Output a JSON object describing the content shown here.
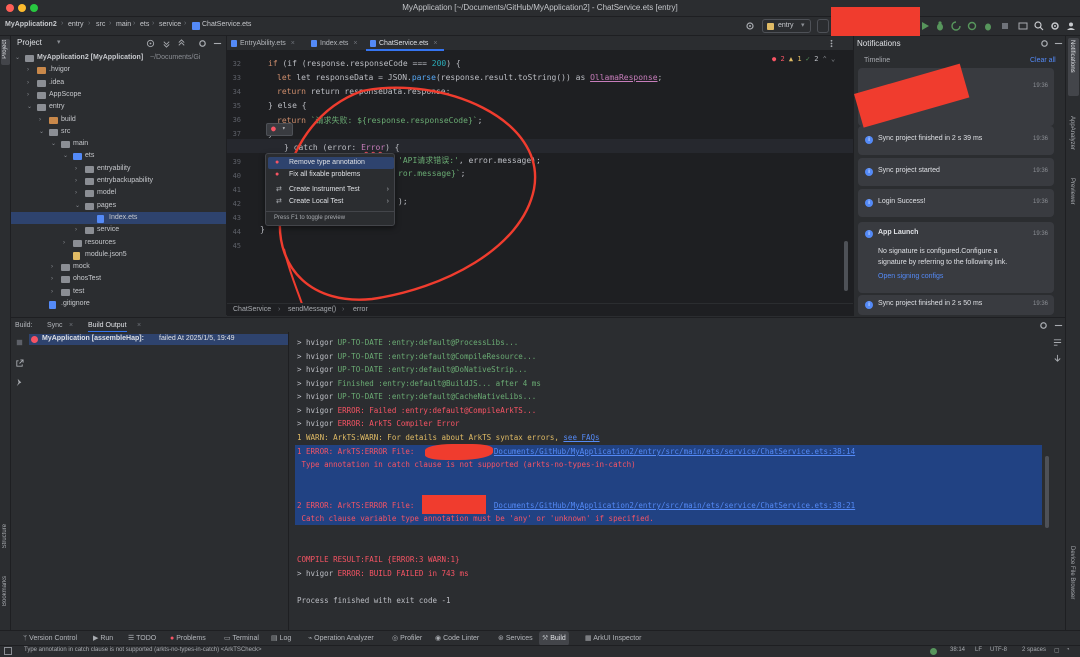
{
  "colors": {
    "accent": "#3574f0",
    "error": "#f75464",
    "success": "#6aab73",
    "warning": "#e0bb65",
    "redaction": "#f03c2e"
  },
  "window": {
    "title": "MyApplication [~/Documents/GitHub/MyApplication2] - ChatService.ets [entry]"
  },
  "navbar": {
    "breadcrumbs": [
      "MyApplication2",
      "entry",
      "src",
      "main",
      "ets",
      "service",
      "ChatService.ets"
    ],
    "run_config": "entry"
  },
  "project_panel": {
    "title": "Project",
    "tree": [
      {
        "label": "MyApplication2 [MyApplication]",
        "suffix": "~/Documents/Gi",
        "depth": 0,
        "expanded": true,
        "kind": "module"
      },
      {
        "label": ".hvigor",
        "depth": 1,
        "expanded": false,
        "kind": "folder-orange"
      },
      {
        "label": ".idea",
        "depth": 1,
        "expanded": false,
        "kind": "folder"
      },
      {
        "label": "AppScope",
        "depth": 1,
        "expanded": false,
        "kind": "folder"
      },
      {
        "label": "entry",
        "depth": 1,
        "expanded": true,
        "kind": "module"
      },
      {
        "label": "build",
        "depth": 2,
        "expanded": false,
        "kind": "folder-orange"
      },
      {
        "label": "src",
        "depth": 2,
        "expanded": true,
        "kind": "folder"
      },
      {
        "label": "main",
        "depth": 3,
        "expanded": true,
        "kind": "folder"
      },
      {
        "label": "ets",
        "depth": 4,
        "expanded": true,
        "kind": "folder-blue"
      },
      {
        "label": "entryability",
        "depth": 5,
        "expanded": false,
        "kind": "folder"
      },
      {
        "label": "entrybackupability",
        "depth": 5,
        "expanded": false,
        "kind": "folder"
      },
      {
        "label": "model",
        "depth": 5,
        "expanded": false,
        "kind": "folder"
      },
      {
        "label": "pages",
        "depth": 5,
        "expanded": true,
        "kind": "folder"
      },
      {
        "label": "Index.ets",
        "depth": 6,
        "kind": "file",
        "selected": true
      },
      {
        "label": "service",
        "depth": 5,
        "expanded": false,
        "kind": "folder"
      },
      {
        "label": "resources",
        "depth": 4,
        "expanded": false,
        "kind": "folder"
      },
      {
        "label": "module.json5",
        "depth": 4,
        "kind": "json"
      },
      {
        "label": "mock",
        "depth": 3,
        "expanded": false,
        "kind": "folder"
      },
      {
        "label": "ohosTest",
        "depth": 3,
        "expanded": false,
        "kind": "folder"
      },
      {
        "label": "test",
        "depth": 3,
        "expanded": false,
        "kind": "folder"
      },
      {
        "label": ".gitignore",
        "depth": 2,
        "kind": "file"
      }
    ]
  },
  "editor": {
    "tabs": [
      {
        "label": "EntryAbility.ets",
        "active": false
      },
      {
        "label": "Index.ets",
        "active": false
      },
      {
        "label": "ChatService.ets",
        "active": true
      }
    ],
    "inspection_counts": {
      "errors": "2",
      "warnings": "1",
      "weak": "2"
    },
    "line_numbers": [
      "32",
      "33",
      "34",
      "35",
      "36",
      "37",
      "38",
      "39",
      "40",
      "41",
      "42",
      "43",
      "44",
      "45"
    ],
    "code": {
      "l32": [
        "if (response.responseCode === ",
        "200",
        ") {"
      ],
      "l33": [
        "let responseData = JSON.",
        "parse",
        "(response.result.toString()) as ",
        "OllamaResponse",
        ";"
      ],
      "l34": [
        "return responseData.response;"
      ],
      "l35": [
        "} else {"
      ],
      "l36": [
        "return ",
        "`请求失败: ${response.responseCode}`",
        ";"
      ],
      "l37": [
        "}"
      ],
      "l38": [
        "} catch (error: ",
        "Error",
        ") {"
      ],
      "l39": [
        "'API请求错误:'",
        ", error.message);"
      ],
      "l40": [
        "ror.message}`",
        ";"
      ],
      "l41": [
        ");"
      ],
      "l43": [
        "}"
      ],
      "l44": [
        "}"
      ]
    },
    "popup": {
      "items": [
        {
          "label": "Remove type annotation",
          "highlighted": true,
          "submenu": false
        },
        {
          "label": "Fix all fixable problems",
          "highlighted": false,
          "submenu": false
        },
        {
          "label": "Create Instrument Test",
          "highlighted": false,
          "submenu": true
        },
        {
          "label": "Create Local Test",
          "highlighted": false,
          "submenu": true
        }
      ],
      "hint": "Press F1 to toggle preview"
    },
    "breadcrumb": [
      "ChatService",
      "sendMessage()",
      "error"
    ]
  },
  "notifications": {
    "title": "Notifications",
    "timeline_label": "Timeline",
    "clear_all": "Clear all",
    "cards": [
      {
        "title": "",
        "time": "19:36"
      },
      {
        "title": "Sync project finished in 2 s 39 ms",
        "time": "19:36"
      },
      {
        "title": "Sync project started",
        "time": "19:36"
      },
      {
        "title": "Login Success!",
        "time": "19:36"
      },
      {
        "title": "App Launch",
        "time": "19:36",
        "body_line1": "No signature is configured.Configure a",
        "body_line2": "signature by referring to the following link.",
        "link": "Open signing configs"
      },
      {
        "title": "Sync project finished in 2 s 50 ms",
        "time": "19:36"
      }
    ]
  },
  "right_stripe": {
    "top": [
      "Notifications",
      "AppAnalyzer",
      "Previewer"
    ],
    "bottom": [
      "Device File Browser"
    ]
  },
  "left_stripe": {
    "top": [
      "Project"
    ],
    "bottom": [
      "Structure",
      "Bookmarks"
    ]
  },
  "build_panel": {
    "tabs": [
      {
        "label": "Build:",
        "active": false
      },
      {
        "label": "Sync",
        "active": false
      },
      {
        "label": "Build Output",
        "active": true
      }
    ],
    "tree_item": {
      "name": "MyApplication [assembleHap]:",
      "status": "failed At 2025/1/5, 19:49"
    },
    "output": [
      {
        "prefix": "> hvigor ",
        "status": "UP-TO-DATE",
        "rest": " :entry:default@ProcessLibs..."
      },
      {
        "prefix": "> hvigor ",
        "status": "UP-TO-DATE",
        "rest": " :entry:default@CompileResource..."
      },
      {
        "prefix": "> hvigor ",
        "status": "UP-TO-DATE",
        "rest": " :entry:default@DoNativeStrip..."
      },
      {
        "prefix": "> hvigor ",
        "status": "Finished",
        "rest": " :entry:default@BuildJS... after 4 ms"
      },
      {
        "prefix": "> hvigor ",
        "status": "UP-TO-DATE",
        "rest": " :entry:default@CacheNativeLibs..."
      },
      {
        "prefix": "> hvigor ",
        "status": "ERROR:",
        "rest": " Failed :entry:default@CompileArkTS..."
      },
      {
        "prefix": "> hvigor ",
        "status": "ERROR:",
        "rest": " ArkTS Compiler Error"
      }
    ],
    "warn_line": {
      "text": "1 WARN: ArkTS:WARN: For details about ArkTS syntax errors, ",
      "link": "see FAQs"
    },
    "error1": {
      "head": "1 ERROR: ArkTS:ERROR File: ",
      "path": "Documents/GitHub/MyApplication2/entry/src/main/ets/service/ChatService.ets:38:14",
      "msg": " Type annotation in catch clause is not supported (arkts-no-types-in-catch)"
    },
    "error2": {
      "head": "2 ERROR: ArkTS:ERROR File: ",
      "path": "Documents/GitHub/MyApplication2/entry/src/main/ets/service/ChatService.ets:38:21",
      "msg": " Catch clause variable type annotation must be 'any' or 'unknown' if specified."
    },
    "result": "COMPILE RESULT:FAIL {ERROR:3 WARN:1}",
    "failed": {
      "prefix": "> hvigor ",
      "status": "ERROR:",
      "rest": " BUILD FAILED in 743 ms"
    },
    "exit": "Process finished with exit code -1"
  },
  "bottom_tools": [
    "Version Control",
    "Run",
    "TODO",
    "Problems",
    "Terminal",
    "Log",
    "Operation Analyzer",
    "Profiler",
    "Code Linter",
    "Services",
    "Build",
    "ArkUI Inspector"
  ],
  "status": {
    "message": "Type annotation in catch clause is not supported (arkts-no-types-in-catch) <ArkTSCheck>",
    "position": "38:14",
    "line_sep": "LF",
    "encoding": "UTF-8",
    "indent": "2 spaces"
  }
}
